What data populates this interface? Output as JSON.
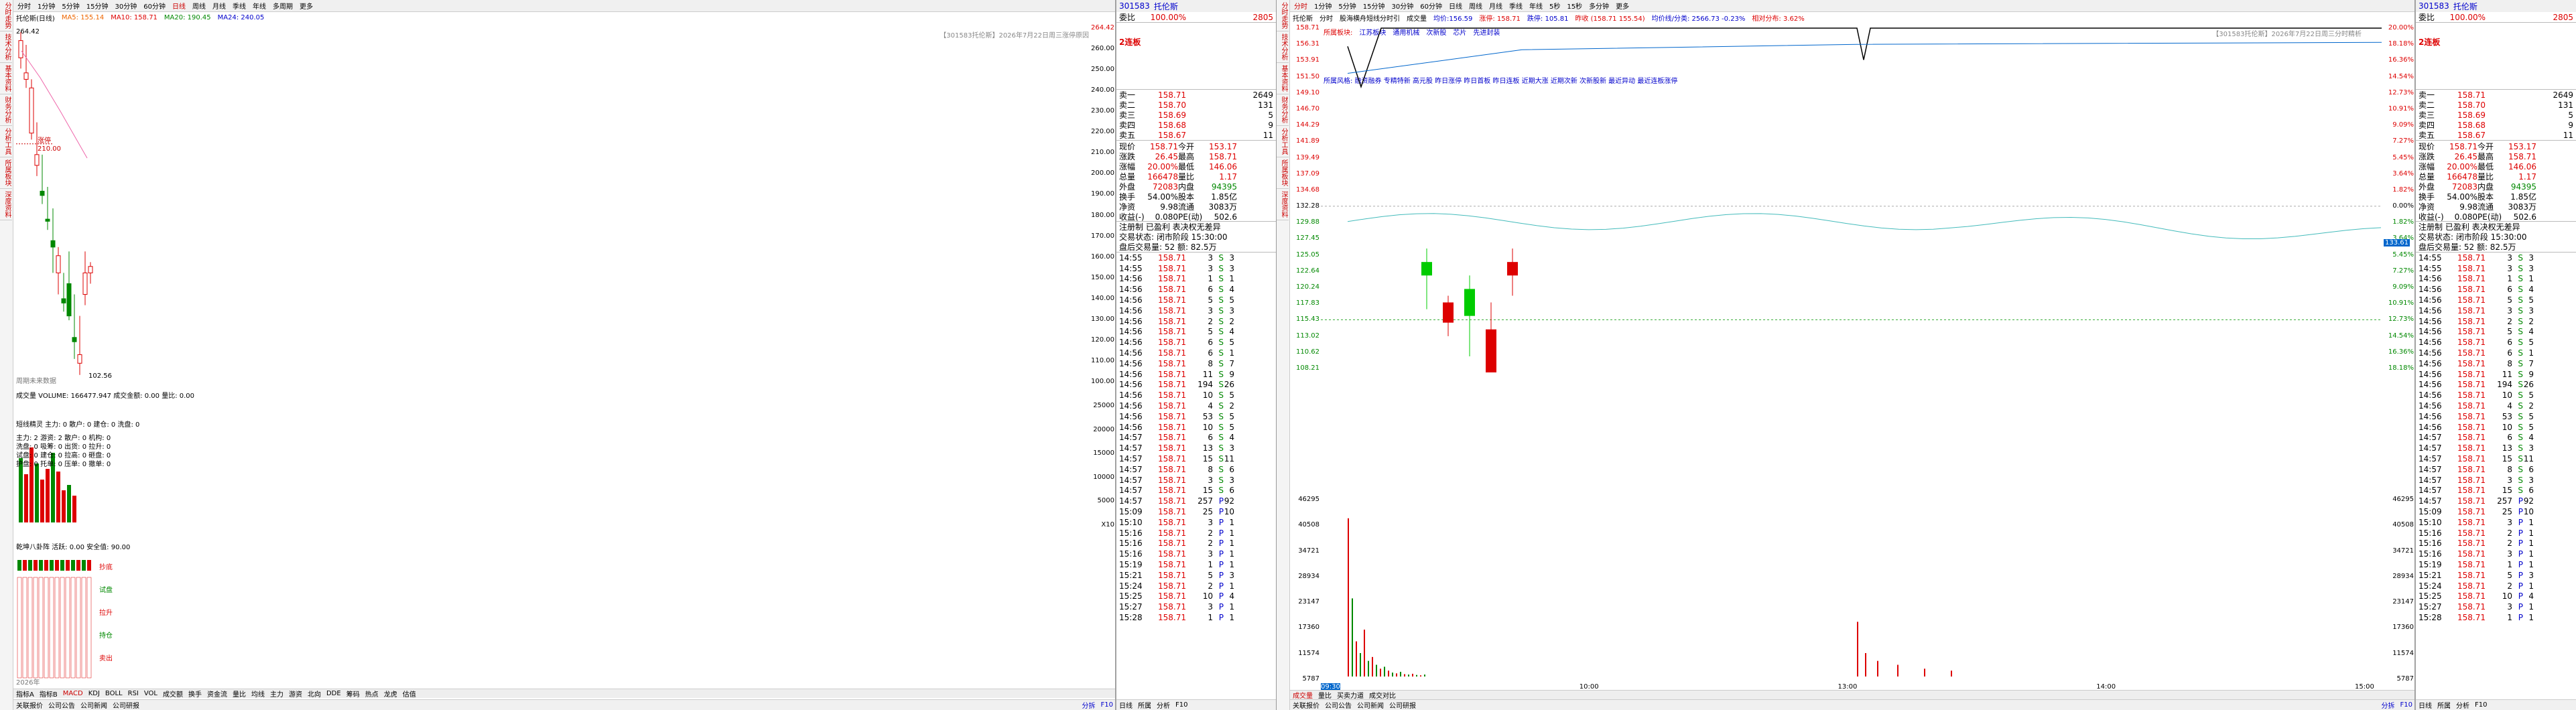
{
  "left": {
    "sidebar_tabs": [
      "分时走势",
      "技术分析",
      "基本资料",
      "财务分析",
      "分析工具",
      "所属板块",
      "深度资料"
    ],
    "periods": [
      "分时",
      "1分钟",
      "5分钟",
      "15分钟",
      "30分钟",
      "60分钟",
      "日线",
      "周线",
      "月线",
      "季线",
      "年线",
      "多周期",
      "更多"
    ],
    "active_period": "日线",
    "info": {
      "ma_label": "托伦斯(日线)",
      "items": [
        "MA5: 155.14",
        "MA10: 158.71",
        "MA20: 190.45",
        "MA24: 240.05"
      ]
    },
    "info_symbol": "MA5",
    "note": "【301583托伦斯】2026年7月22日周三涨停原因",
    "price_axis": [
      "264.42",
      "260.00",
      "250.00",
      "240.00",
      "230.00",
      "220.00",
      "210.00",
      "200.00",
      "190.00",
      "180.00",
      "170.00",
      "160.00",
      "150.00",
      "140.00",
      "130.00",
      "120.00",
      "110.00",
      "100.00"
    ],
    "high_label": "264.42",
    "peak_label": "涨停",
    "peak_value": "210.00",
    "low_label": "102.56",
    "bottom_note": "周期未来数据",
    "vol_header": "成交量 VOLUME: 166477.947  成交金额: 0.00  量比: 0.00",
    "vol_axis": [
      "25000",
      "20000",
      "15000",
      "10000",
      "5000",
      "X10"
    ],
    "indicator_header": "短线精灵  主力: 0  散户: 0  建仓: 0  洗盘: 0",
    "indicator_rows": [
      "主力: 2  游资: 2  散户: 0  机构: 0",
      "洗盘: 0  吸筹: 0  出货: 0  拉升: 0",
      "试盘: 0  建仓: 0  拉高: 0  砸盘: 0",
      "护盘: 0  托单: 0  压单: 0  撤单: 0"
    ],
    "bottom_section_header": "乾坤八卦阵  活跃: 0.00  安全值: 90.00",
    "bottom_section_labels": [
      "抄底",
      "试盘",
      "拉升",
      "持仓",
      "卖出"
    ],
    "bottom_date": "2026年",
    "tabs": [
      "指标A",
      "指标B",
      "MACD",
      "KDJ",
      "BOLL",
      "RSI",
      "VOL",
      "成交额",
      "换手",
      "资金流",
      "量比",
      "均线",
      "主力",
      "游资",
      "北向",
      "DDE",
      "筹码",
      "热点",
      "龙虎",
      "估值"
    ],
    "bottom": [
      "关联报价",
      "公司公告",
      "公司新闻",
      "公司研报"
    ],
    "bottom_right": [
      "分拆",
      "F10"
    ]
  },
  "leftQuote": {
    "code": "301583",
    "name": "托伦斯",
    "weibi_label": "委比",
    "weibi": "100.00%",
    "weicha": "2805",
    "board": "2连板",
    "sells": [
      {
        "label": "卖一",
        "price": "158.71",
        "vol": "2649"
      },
      {
        "label": "卖二",
        "price": "158.70",
        "vol": "131"
      },
      {
        "label": "卖三",
        "price": "158.69",
        "vol": "5"
      },
      {
        "label": "卖四",
        "price": "158.68",
        "vol": "9"
      },
      {
        "label": "卖五",
        "price": "158.67",
        "vol": "11"
      }
    ],
    "stats": [
      [
        "现价",
        "158.71",
        "今开",
        "153.17"
      ],
      [
        "涨跌",
        "26.45",
        "最高",
        "158.71"
      ],
      [
        "涨幅",
        "20.00%",
        "最低",
        "146.06"
      ],
      [
        "总量",
        "166478",
        "量比",
        "1.17"
      ],
      [
        "外盘",
        "72083",
        "内盘",
        "94395"
      ],
      [
        "换手",
        "54.00%",
        "股本",
        "1.85亿"
      ],
      [
        "净资",
        "9.98",
        "流通",
        "3083万"
      ],
      [
        "收益(-)",
        "0.080",
        "PE(动)",
        "502.6"
      ]
    ],
    "extra": [
      "注册制  已盈利  表决权无差异",
      "交易状态: 闭市阶段 15:30:00",
      "盘后交易量: 52  额: 82.5万"
    ],
    "ticks": [
      [
        "14:55",
        "158.71",
        "3",
        "S",
        "3"
      ],
      [
        "14:55",
        "158.71",
        "3",
        "S",
        "3"
      ],
      [
        "14:56",
        "158.71",
        "1",
        "S",
        "1"
      ],
      [
        "14:56",
        "158.71",
        "6",
        "S",
        "4"
      ],
      [
        "14:56",
        "158.71",
        "5",
        "S",
        "5"
      ],
      [
        "14:56",
        "158.71",
        "3",
        "S",
        "3"
      ],
      [
        "14:56",
        "158.71",
        "2",
        "S",
        "2"
      ],
      [
        "14:56",
        "158.71",
        "5",
        "S",
        "4"
      ],
      [
        "14:56",
        "158.71",
        "6",
        "S",
        "5"
      ],
      [
        "14:56",
        "158.71",
        "6",
        "S",
        "1"
      ],
      [
        "14:56",
        "158.71",
        "8",
        "S",
        "7"
      ],
      [
        "14:56",
        "158.71",
        "11",
        "S",
        "9"
      ],
      [
        "14:56",
        "158.71",
        "194",
        "S",
        "26"
      ],
      [
        "14:56",
        "158.71",
        "10",
        "S",
        "5"
      ],
      [
        "14:56",
        "158.71",
        "4",
        "S",
        "2"
      ],
      [
        "14:56",
        "158.71",
        "53",
        "S",
        "5"
      ],
      [
        "14:56",
        "158.71",
        "10",
        "S",
        "5"
      ],
      [
        "14:57",
        "158.71",
        "6",
        "S",
        "4"
      ],
      [
        "14:57",
        "158.71",
        "13",
        "S",
        "3"
      ],
      [
        "14:57",
        "158.71",
        "15",
        "S",
        "11"
      ],
      [
        "14:57",
        "158.71",
        "8",
        "S",
        "6"
      ],
      [
        "14:57",
        "158.71",
        "3",
        "S",
        "3"
      ],
      [
        "14:57",
        "158.71",
        "15",
        "S",
        "6"
      ],
      [
        "14:57",
        "158.71",
        "257",
        "P",
        "92"
      ],
      [
        "15:09",
        "158.71",
        "25",
        "P",
        "10"
      ],
      [
        "15:10",
        "158.71",
        "3",
        "P",
        "1"
      ],
      [
        "15:16",
        "158.71",
        "2",
        "P",
        "1"
      ],
      [
        "15:16",
        "158.71",
        "2",
        "P",
        "1"
      ],
      [
        "15:16",
        "158.71",
        "3",
        "P",
        "1"
      ],
      [
        "15:19",
        "158.71",
        "1",
        "P",
        "1"
      ],
      [
        "15:21",
        "158.71",
        "5",
        "P",
        "3"
      ],
      [
        "15:24",
        "158.71",
        "2",
        "P",
        "1"
      ],
      [
        "15:25",
        "158.71",
        "10",
        "P",
        "4"
      ],
      [
        "15:27",
        "158.71",
        "3",
        "P",
        "1"
      ],
      [
        "15:28",
        "158.71",
        "1",
        "P",
        "1"
      ]
    ],
    "footer": [
      "日线",
      "所属",
      "分析",
      "F10"
    ]
  },
  "right": {
    "sidebar_tabs": [
      "分时走势",
      "技术分析",
      "基本资料",
      "财务分析",
      "分析工具",
      "所属板块",
      "深度资料"
    ],
    "periods": [
      "分时",
      "1分钟",
      "5分钟",
      "15分钟",
      "30分钟",
      "60分钟",
      "日线",
      "周线",
      "月线",
      "季线",
      "年线",
      "5秒",
      "15秒",
      "多分钟",
      "更多"
    ],
    "active_period": "分时",
    "info": [
      "托伦斯",
      "分时",
      "股海横舟短线分时引",
      "成交量",
      "均价:156.59",
      "涨停: 158.71",
      "跌停: 105.81",
      "昨收 (158.71 155.54)",
      "均价线/分类: 2566.73 -0.23%",
      "相对分布: 3.62%"
    ],
    "note": "【301583托伦斯】2026年7月22日周三分时精析",
    "price_axis": [
      "158.71",
      "156.31",
      "153.91",
      "151.50",
      "149.10",
      "146.70",
      "144.29",
      "141.89",
      "139.49",
      "137.09",
      "134.68",
      "132.28",
      "129.88",
      "127.45",
      "125.05",
      "122.64",
      "120.24",
      "117.83",
      "115.43",
      "113.02",
      "110.62",
      "108.21"
    ],
    "pct_axis": [
      "20.00%",
      "18.18%",
      "16.36%",
      "14.54%",
      "12.73%",
      "10.91%",
      "9.09%",
      "7.27%",
      "5.45%",
      "3.64%",
      "1.82%",
      "0.00%",
      "1.82%",
      "3.64%",
      "5.45%",
      "7.27%",
      "9.09%",
      "10.91%",
      "12.73%",
      "14.54%",
      "16.36%",
      "18.18%"
    ],
    "tags": [
      "所属板块:",
      "江苏板块",
      "通用机械",
      "次新股",
      "芯片",
      "先进封装"
    ],
    "concepts": "所属风格:  融资融券  专精特新  高元股  昨日涨停  昨日首板  昨日连板  近期大涨  近期次新  次新股新  最近异动  最近连板涨停",
    "current_price_tag": "133.61",
    "vol_axis": [
      "46295",
      "40508",
      "34721",
      "28934",
      "23147",
      "17360",
      "11574",
      "5787"
    ],
    "time_axis": [
      "09:30",
      "10:00",
      "13:00",
      "14:00",
      "15:00"
    ],
    "start_label": "09:30",
    "tabs": [
      "成交量",
      "量比",
      "买卖力道",
      "成交对比"
    ],
    "bottom": [
      "关联报价",
      "公司公告",
      "公司新闻",
      "公司研报"
    ],
    "bottom_right": [
      "分拆",
      "F10"
    ]
  }
}
